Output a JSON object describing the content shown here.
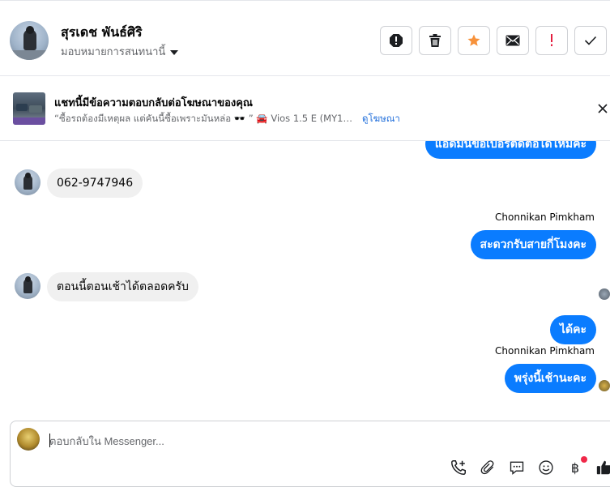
{
  "header": {
    "contact_name": "สุรเดช พันธ์ศิริ",
    "assign_label": "มอบหมายการสนทนานี้",
    "actions": [
      "report-icon",
      "trash-icon",
      "star-icon",
      "mail-icon",
      "flag-icon",
      "check-icon"
    ],
    "star_color": "#f7923b",
    "flag_color": "#e41e3f"
  },
  "ad_banner": {
    "title": "แชทนี้มีข้อความตอบกลับต่อโฆษณาของคุณ",
    "description": "“ซื้อรถต้องมีเหตุผล แต่คันนี้ซื้อเพราะมันหล่อ 🕶️ ” 🚘 Vios 1.5 E (MY13) ...",
    "link": "ดูโฆษณา"
  },
  "messages": [
    {
      "direction": "out",
      "text": "แอดมินขอเบอร์ติดต่อได้ไหมคะ"
    },
    {
      "direction": "in",
      "text": "062-9747946"
    },
    {
      "direction": "out",
      "sender": "Chonnikan Pimkham",
      "text": "สะดวกรับสายกี่โมงคะ"
    },
    {
      "direction": "in",
      "text": "ตอนนี้ตอนเช้าได้ตลอดครับ"
    },
    {
      "direction": "out",
      "text": "ได้คะ"
    },
    {
      "direction": "out",
      "sender": "Chonnikan Pimkham",
      "text": "พรุ่งนี้เช้านะคะ"
    }
  ],
  "composer": {
    "placeholder": "ตอบกลับใน Messenger...",
    "tools": [
      "phone-plus-icon",
      "paperclip-icon",
      "chat-bubble-icon",
      "emoji-icon",
      "baht-icon",
      "thumbs-up-icon"
    ],
    "baht_symbol": "฿",
    "accent": "#0a7cff"
  }
}
